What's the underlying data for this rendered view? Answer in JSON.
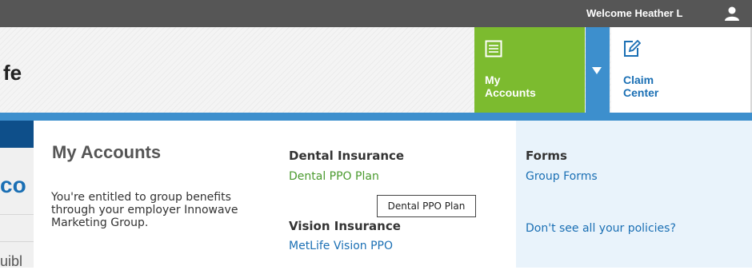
{
  "topbar": {
    "welcome": "Welcome Heather L",
    "user_icon": "user-icon"
  },
  "header": {
    "logo_fragment": "fe",
    "tabs": [
      {
        "label": "My\nAccounts",
        "icon": "document-list-icon",
        "color": "#7cbb2f",
        "active": true
      },
      {
        "label": "▼",
        "icon": "dropdown-arrow-icon",
        "color": "#3d8fcd"
      },
      {
        "label": "Claim\nCenter",
        "icon": "edit-document-icon",
        "color": "#1a6fb4"
      }
    ]
  },
  "background": {
    "heading_fragment": "co",
    "text_fragment": "uibl"
  },
  "dropdown": {
    "title": "My Accounts",
    "description": "You're entitled to group benefits through your employer Innowave Marketing Group.",
    "sections": [
      {
        "heading": "Dental Insurance",
        "link": "Dental PPO Plan"
      },
      {
        "heading": "Vision Insurance",
        "link": "MetLife Vision PPO"
      }
    ],
    "forms": {
      "heading": "Forms",
      "link": "Group Forms",
      "policies_link": "Don't see all your policies?"
    }
  },
  "tooltip": {
    "text": "Dental PPO Plan"
  },
  "colors": {
    "topbar": "#565656",
    "accent_green": "#7cbb2f",
    "accent_blue": "#3d8fcd",
    "link_blue": "#1a6fb4",
    "link_green": "#4a9a2e",
    "panel_right_bg": "#e9f3fb"
  }
}
